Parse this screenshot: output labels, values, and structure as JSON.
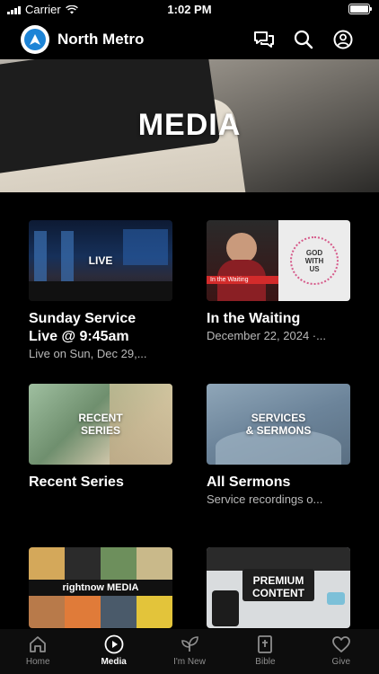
{
  "status_bar": {
    "carrier": "Carrier",
    "time": "1:02 PM"
  },
  "header": {
    "title": "North Metro",
    "icons": [
      "chat-icon",
      "search-icon",
      "profile-icon"
    ]
  },
  "hero": {
    "title": "MEDIA"
  },
  "cards": [
    {
      "thumb_label": "LIVE",
      "title": "Sunday Service\nLive @ 9:45am",
      "subtitle": "Live on Sun, Dec 29,..."
    },
    {
      "thumb_label": "In the Waiting",
      "thumb_badge": "GOD\nWITH\nUS",
      "title": "In the Waiting",
      "subtitle": "December 22, 2024 ·..."
    },
    {
      "thumb_label": "RECENT\nSERIES",
      "title": "Recent Series",
      "subtitle": ""
    },
    {
      "thumb_label": "SERVICES\n& SERMONS",
      "title": "All Sermons",
      "subtitle": "Service recordings o..."
    },
    {
      "thumb_label": "rightnow MEDIA",
      "title": "",
      "subtitle": ""
    },
    {
      "thumb_label": "PREMIUM\nCONTENT",
      "title": "",
      "subtitle": ""
    }
  ],
  "tabs": [
    {
      "label": "Home",
      "icon": "home-icon",
      "active": false
    },
    {
      "label": "Media",
      "icon": "play-icon",
      "active": true
    },
    {
      "label": "I'm New",
      "icon": "sprout-icon",
      "active": false
    },
    {
      "label": "Bible",
      "icon": "bible-icon",
      "active": false
    },
    {
      "label": "Give",
      "icon": "heart-icon",
      "active": false
    }
  ],
  "colors": {
    "accent": "#1e84d6",
    "background": "#000000",
    "tab_inactive": "#8e8e8e"
  }
}
